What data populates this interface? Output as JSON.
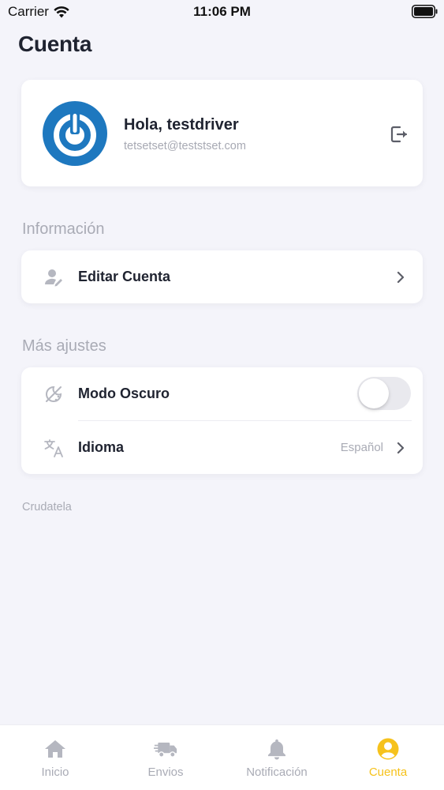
{
  "status_bar": {
    "carrier": "Carrier",
    "time": "11:06 PM"
  },
  "page_title": "Cuenta",
  "profile": {
    "greeting": "Hola, testdriver",
    "email": "tetsetset@teststset.com"
  },
  "sections": {
    "info_label": "Información",
    "more_label": "Más ajustes"
  },
  "rows": {
    "edit_account": "Editar Cuenta",
    "dark_mode": "Modo Oscuro",
    "dark_mode_on": false,
    "language": "Idioma",
    "language_value": "Español"
  },
  "footer": "Crudatela",
  "tabs": [
    {
      "label": "Inicio",
      "icon": "home-icon",
      "active": false
    },
    {
      "label": "Envios",
      "icon": "truck-icon",
      "active": false
    },
    {
      "label": "Notificación",
      "icon": "bell-icon",
      "active": false
    },
    {
      "label": "Cuenta",
      "icon": "user-circle-icon",
      "active": true
    }
  ],
  "colors": {
    "accent": "#f6c21c",
    "avatar_blue": "#1e78bf",
    "background": "#f4f4fa",
    "muted": "#a9abb5"
  }
}
